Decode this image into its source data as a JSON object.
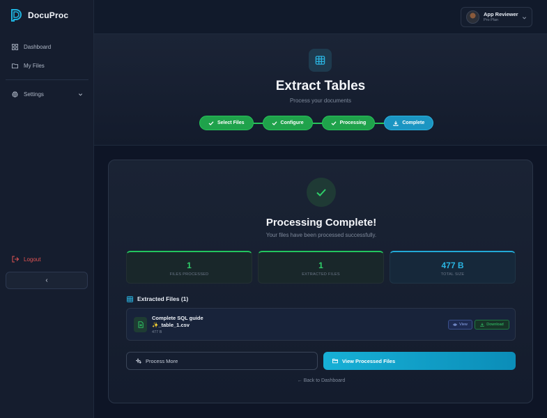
{
  "app": {
    "name": "DocuProc",
    "logo_icon": "docuproc-logo-icon",
    "accent": "#22a9d6"
  },
  "sidebar": {
    "items": [
      {
        "label": "Dashboard",
        "icon": "grid-icon"
      },
      {
        "label": "My Files",
        "icon": "folder-icon"
      }
    ],
    "settings_label": "Settings",
    "logout_label": "Logout",
    "collapse_label": "‹"
  },
  "user": {
    "name": "App Reviewer",
    "plan": "Pro Plan"
  },
  "hero": {
    "title": "Extract Tables",
    "subtitle": "Process your documents",
    "steps": [
      {
        "label": "Select Files",
        "state": "done"
      },
      {
        "label": "Configure",
        "state": "done"
      },
      {
        "label": "Processing",
        "state": "done"
      },
      {
        "label": "Complete",
        "state": "active"
      }
    ]
  },
  "result": {
    "title": "Processing Complete!",
    "subtitle": "Your files have been processed successfully.",
    "stats": [
      {
        "value": "1",
        "label": "FILES PROCESSED"
      },
      {
        "value": "1",
        "label": "EXTRACTED FILES"
      },
      {
        "value": "477 B",
        "label": "TOTAL SIZE"
      }
    ],
    "files_heading": "Extracted Files (1)",
    "files": [
      {
        "name": "Complete SQL guide ✨_table_1.csv",
        "size": "477 B",
        "view_label": "View",
        "download_label": "Download"
      }
    ],
    "process_more_label": "Process More",
    "view_processed_label": "View Processed Files",
    "back_label": "← Back to Dashboard"
  },
  "colors": {
    "success": "#22c55e",
    "info": "#22a9d6",
    "danger": "#e05353",
    "background": "#0e1526"
  }
}
